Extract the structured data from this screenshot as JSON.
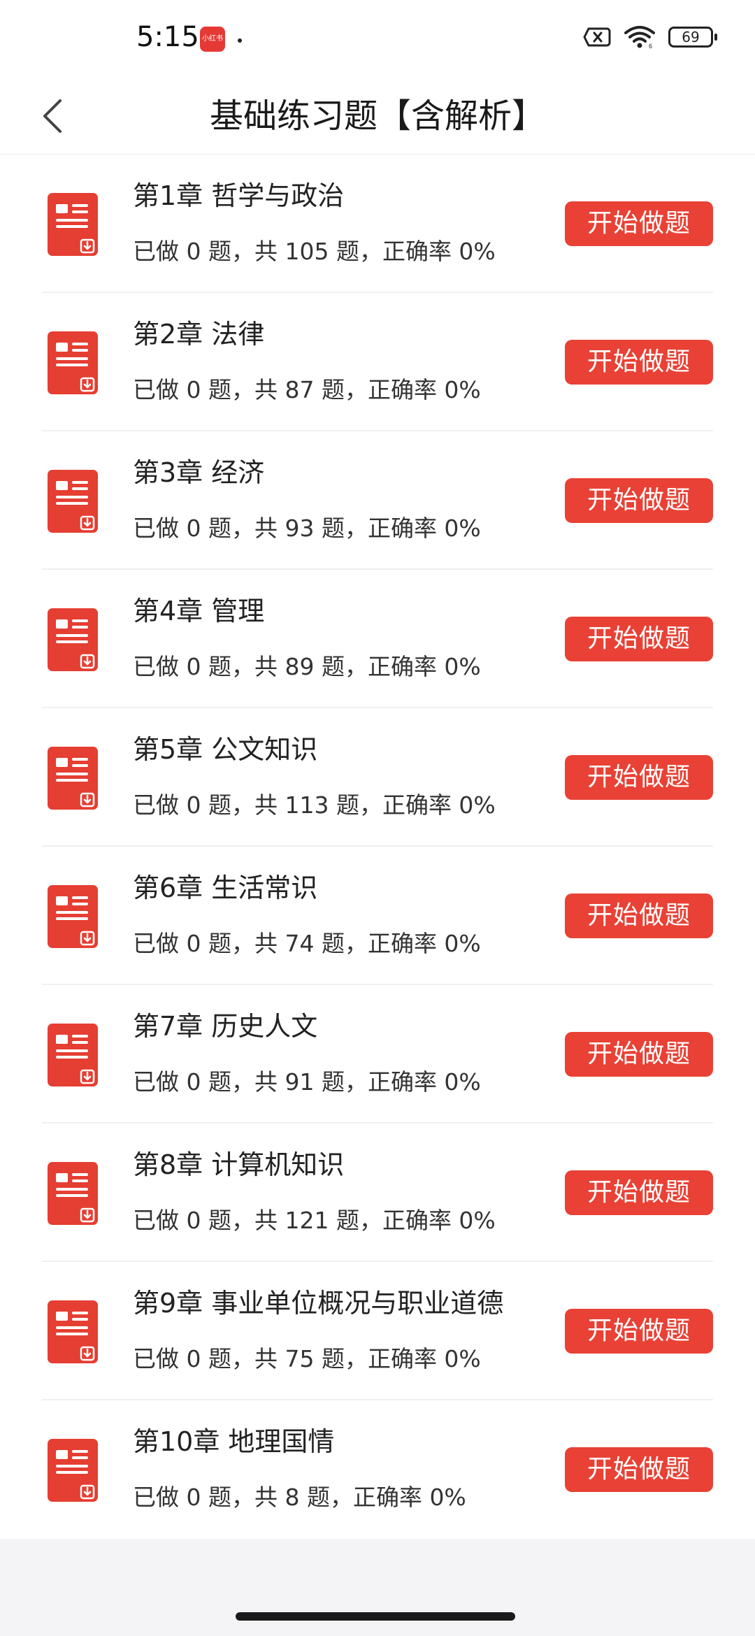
{
  "status_bar": {
    "time": "5:15",
    "app_badge": "小红书",
    "battery": "69",
    "icons": [
      "sim-off-icon",
      "wifi-icon",
      "battery-icon"
    ]
  },
  "header": {
    "title": "基础练习题【含解析】",
    "back_icon": "chevron-left-icon"
  },
  "colors": {
    "accent": "#e94135",
    "icon_red": "#e53e32",
    "background": "#f4f4f6"
  },
  "chapters": [
    {
      "title": "第1章 哲学与政治",
      "stats": "已做 0 题，共 105 题，正确率 0%",
      "button": "开始做题"
    },
    {
      "title": "第2章 法律",
      "stats": "已做 0 题，共 87 题，正确率 0%",
      "button": "开始做题"
    },
    {
      "title": "第3章 经济",
      "stats": "已做 0 题，共 93 题，正确率 0%",
      "button": "开始做题"
    },
    {
      "title": "第4章 管理",
      "stats": "已做 0 题，共 89 题，正确率 0%",
      "button": "开始做题"
    },
    {
      "title": "第5章 公文知识",
      "stats": "已做 0 题，共 113 题，正确率 0%",
      "button": "开始做题"
    },
    {
      "title": "第6章 生活常识",
      "stats": "已做 0 题，共 74 题，正确率 0%",
      "button": "开始做题"
    },
    {
      "title": "第7章 历史人文",
      "stats": "已做 0 题，共 91 题，正确率 0%",
      "button": "开始做题"
    },
    {
      "title": "第8章 计算机知识",
      "stats": "已做 0 题，共 121 题，正确率 0%",
      "button": "开始做题"
    },
    {
      "title": "第9章 事业单位概况与职业道德",
      "stats": "已做 0 题，共 75 题，正确率 0%",
      "button": "开始做题"
    },
    {
      "title": "第10章 地理国情",
      "stats": "已做 0 题，共 8 题，正确率 0%",
      "button": "开始做题"
    }
  ]
}
